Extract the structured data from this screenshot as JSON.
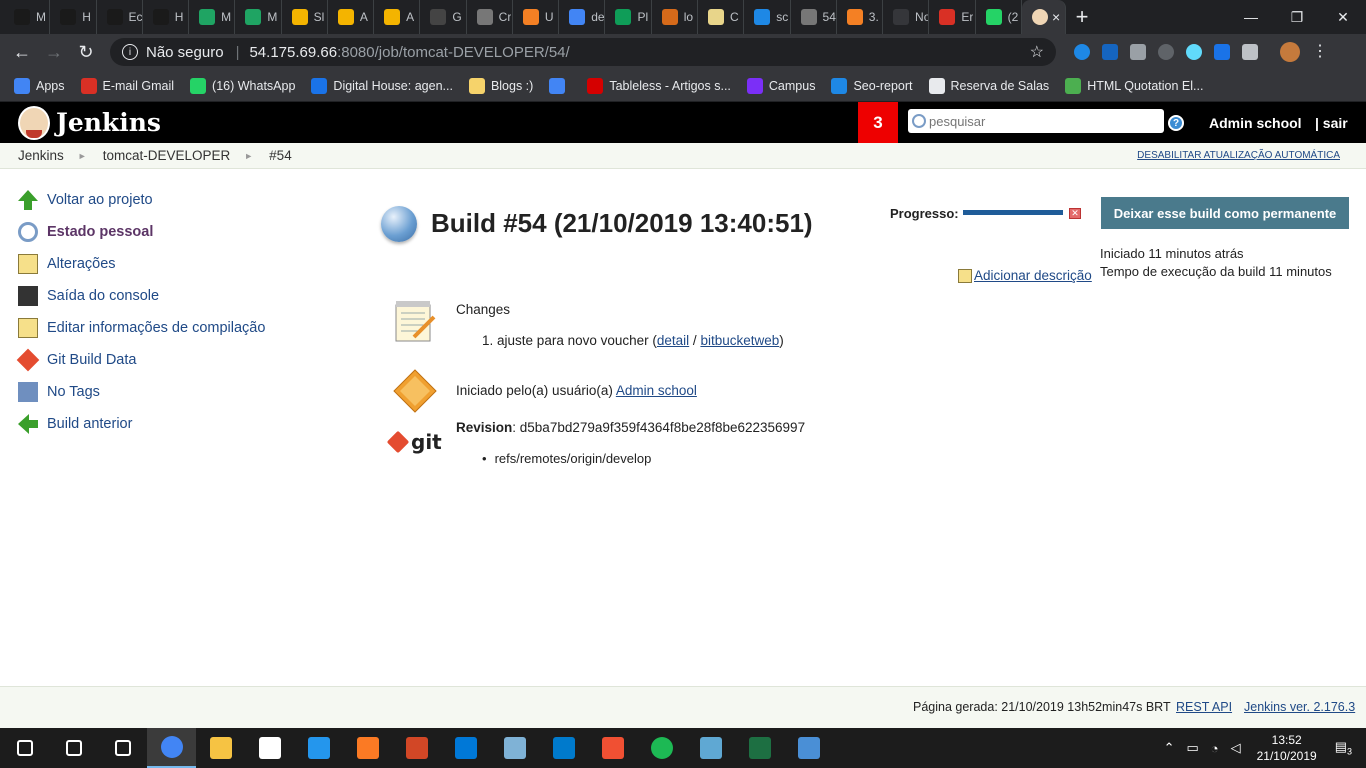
{
  "browser": {
    "tabs": [
      {
        "label": "M",
        "color": "#1a1a1a"
      },
      {
        "label": "H",
        "color": "#1a1a1a"
      },
      {
        "label": "Ec",
        "color": "#1a1a1a"
      },
      {
        "label": "H",
        "color": "#1a1a1a"
      },
      {
        "label": "M",
        "color": "#1fa463"
      },
      {
        "label": "M",
        "color": "#1fa463"
      },
      {
        "label": "Sl",
        "color": "#f4b400"
      },
      {
        "label": "A",
        "color": "#f4b400"
      },
      {
        "label": "A",
        "color": "#f4b400"
      },
      {
        "label": "G",
        "color": "#444"
      },
      {
        "label": "Cr",
        "color": "#777"
      },
      {
        "label": "U",
        "color": "#f48024"
      },
      {
        "label": "de",
        "color": "#4285f4"
      },
      {
        "label": "Pl",
        "color": "#0f9d58"
      },
      {
        "label": "lo",
        "color": "#d66a1a"
      },
      {
        "label": "C",
        "color": "#e8d58a"
      },
      {
        "label": "sc",
        "color": "#1e88e5"
      },
      {
        "label": "54",
        "color": "#777"
      },
      {
        "label": "3.",
        "color": "#f48024"
      },
      {
        "label": "Nova",
        "color": "#35363a"
      },
      {
        "label": "Er",
        "color": "#d93025"
      },
      {
        "label": "(2",
        "color": "#25d366"
      }
    ],
    "active_tab_close": "×",
    "new_tab": "+",
    "window_controls": [
      "—",
      "❐",
      "✕"
    ],
    "nav": {
      "back": "←",
      "forward": "→",
      "reload": "↻"
    },
    "omnibox": {
      "security": "Não seguro",
      "host": "54.175.69.66",
      "path": ":8080/job/tomcat-DEVELOPER/54/",
      "star": "☆"
    },
    "bookmarks": [
      {
        "label": "Apps",
        "color": "#4285f4"
      },
      {
        "label": "E-mail Gmail",
        "color": "#d93025"
      },
      {
        "label": "(16) WhatsApp",
        "color": "#25d366"
      },
      {
        "label": "Digital House: agen...",
        "color": "#1a73e8"
      },
      {
        "label": "Blogs :)",
        "color": "#f6d36b"
      },
      {
        "label": "",
        "color": "#4285f4"
      },
      {
        "label": "Tableless - Artigos s...",
        "color": "#d50000"
      },
      {
        "label": "Campus",
        "color": "#7b2ff7"
      },
      {
        "label": "Seo-report",
        "color": "#1e88e5"
      },
      {
        "label": "Reserva de Salas",
        "color": "#e8eaed"
      },
      {
        "label": "HTML Quotation El...",
        "color": "#4caf50"
      }
    ]
  },
  "jenkins": {
    "title": "Jenkins",
    "notifications": "3",
    "search_placeholder": "pesquisar",
    "help": "?",
    "user": "Admin school",
    "logout": "| sair",
    "breadcrumb": [
      "Jenkins",
      "tomcat-DEVELOPER",
      "#54"
    ],
    "breadcrumb_sep": "►",
    "autorefresh": "DESABILITAR ATUALIZAÇÃO AUTOMÁTICA",
    "side_tasks": [
      {
        "label": "Voltar ao projeto",
        "icon": "up-arrow-icon",
        "color": "#3a9f2b",
        "bold": false
      },
      {
        "label": "Estado pessoal",
        "icon": "magnifier-icon",
        "color": "#7a9cc6",
        "bold": true
      },
      {
        "label": "Alterações",
        "icon": "notepad-icon",
        "color": "#f6e08a",
        "bold": false
      },
      {
        "label": "Saída do console",
        "icon": "terminal-icon",
        "color": "#333333",
        "bold": false
      },
      {
        "label": "Editar informações de compilação",
        "icon": "notepad-icon",
        "color": "#f6e08a",
        "bold": false
      },
      {
        "label": "Git Build Data",
        "icon": "git-icon",
        "color": "#e44c30",
        "bold": false
      },
      {
        "label": "No Tags",
        "icon": "save-icon",
        "color": "#6f8fbf",
        "bold": false
      },
      {
        "label": "Build anterior",
        "icon": "left-arrow-icon",
        "color": "#3a9f2b",
        "bold": false
      }
    ],
    "build": {
      "title": "Build #54 (21/10/2019 13:40:51)",
      "progress_label": "Progresso:",
      "progress_fraction": 1.0,
      "progress_stop": "✕",
      "keep_button": "Deixar esse build como permanente",
      "started_ago": "Iniciado 11 minutos atrás",
      "duration": "Tempo de execução da build 11 minutos",
      "add_description": "Adicionar descrição",
      "changes_label": "Changes",
      "change_index": "1.",
      "change_text": "ajuste para novo voucher (",
      "change_detail": "detail",
      "change_slash": " / ",
      "change_bitbucket": "bitbucketweb",
      "change_close": ")",
      "started_by_prefix": "Iniciado pelo(a) usuário(a) ",
      "started_by_user": "Admin school",
      "revision_label": "Revision",
      "revision_value": ": d5ba7bd279a9f359f4364f8be28f8be622356997",
      "git_label": "git",
      "ref": "refs/remotes/origin/develop"
    },
    "footer": {
      "generated": "Página gerada: 21/10/2019 13h52min47s BRT",
      "rest_api": "REST API",
      "version": "Jenkins ver. 2.176.3"
    }
  },
  "taskbar": {
    "apps": [
      {
        "name": "windows-start-icon",
        "color": "#ffffff"
      },
      {
        "name": "search-icon",
        "color": "#ffffff"
      },
      {
        "name": "task-view-icon",
        "color": "#ffffff"
      },
      {
        "name": "chrome-icon",
        "color": "#4285f4"
      },
      {
        "name": "file-explorer-icon",
        "color": "#f6c343"
      },
      {
        "name": "mail-icon",
        "color": "#ffffff"
      },
      {
        "name": "docker-icon",
        "color": "#2496ed"
      },
      {
        "name": "xampp-icon",
        "color": "#fb7a24"
      },
      {
        "name": "powerpoint-icon",
        "color": "#d24726"
      },
      {
        "name": "edge-icon",
        "color": "#0078d7"
      },
      {
        "name": "notepad-icon",
        "color": "#7fb2d6"
      },
      {
        "name": "vscode-icon",
        "color": "#007acc"
      },
      {
        "name": "git-gui-icon",
        "color": "#f05033"
      },
      {
        "name": "spotify-icon",
        "color": "#1db954"
      },
      {
        "name": "network-tool-icon",
        "color": "#5fa8d3"
      },
      {
        "name": "excel-icon",
        "color": "#1d6f42"
      },
      {
        "name": "remote-desktop-icon",
        "color": "#4a8fd6"
      }
    ],
    "time": "13:52",
    "date": "21/10/2019",
    "notifications": "3"
  }
}
